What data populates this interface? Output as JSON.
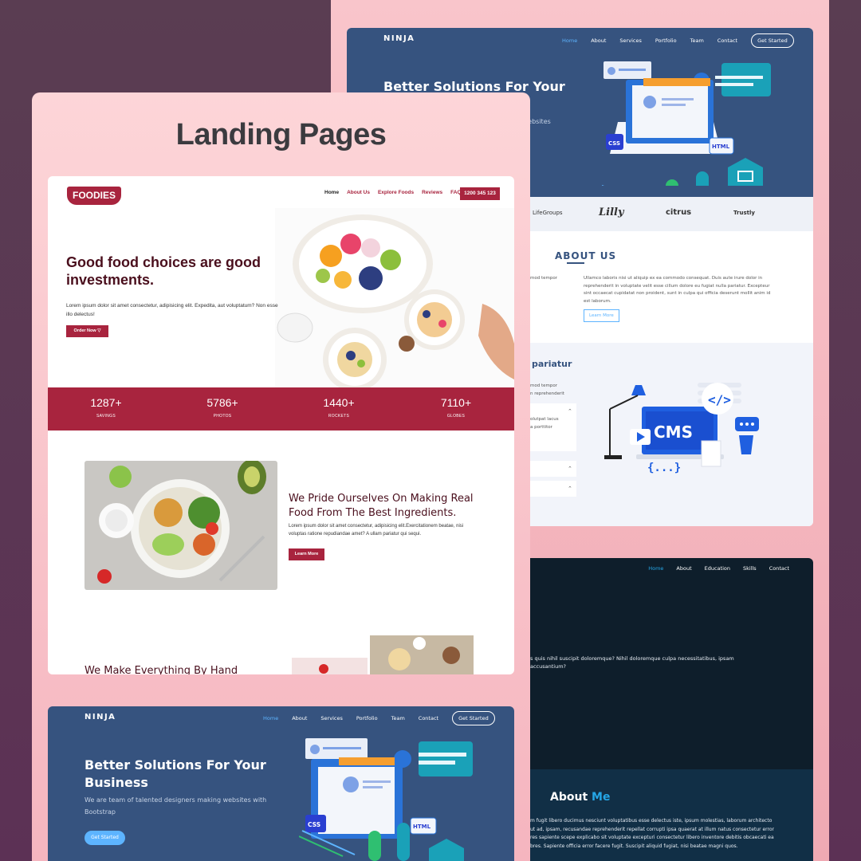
{
  "page_title": "Landing Pages",
  "colors": {
    "foodies_brand": "#a8243e",
    "ninja_brand": "#36537f",
    "ninja_accent": "#5db4ff",
    "dark_bg": "#0e1e2b"
  },
  "ninja_top": {
    "logo": "NINJA",
    "nav": [
      "Home",
      "About",
      "Services",
      "Portfolio",
      "Team",
      "Contact"
    ],
    "cta": "Get Started",
    "hero_heading": "Better Solutions For Your",
    "hero_sub_visible": "g websites",
    "partner_logos": [
      "LifeGroups",
      "Lilly",
      "citrus",
      "Trustly"
    ],
    "about_heading": "ABOUT US",
    "about_left": "mod tempor",
    "about_right": "Ullamco laboris nisi ut aliquip ex ea commodo consequat. Duis aute irure dolor in reprehenderit in voluptate velit esse cillum dolore eu fugiat nulla pariatur. Excepteur sint occaecat cupidatat non proident, sunt in culpa qui officia deserunt mollit anim id est laborum.",
    "about_button": "Learn More",
    "faq_heading": "pariatur",
    "faq_text_1": "mod tempor",
    "faq_text_2": "n reprehenderit",
    "faq_item_text": "olutpat lacus\na porttitor",
    "illustration_label": "CMS"
  },
  "dark_portfolio": {
    "nav": [
      "Home",
      "About",
      "Education",
      "Skills",
      "Contact"
    ],
    "intro_text": "s quis nihil suscipit doloremque? Nihil doloremque culpa necessitatibus, ipsam\naccusantium?",
    "about_heading_1": "About",
    "about_heading_2": "Me",
    "about_text": "m fugit libero ducimus nesciunt voluptatibus esse delectus iste, ipsum molestias, laborum architecto\nut ad, ipsam, recusandae reprehenderit repellat corrupti ipsa quaerat at illum natus consectetur error\nres sapiente scepe explicabo sit voluptate excepturi consectetur libero inventore debitis obcaecati ea\nbres. Sapiente officia error facere fugit. Suscipit aliquid fugiat, nisi beatae magni quos."
  },
  "foodies": {
    "logo": "FOODIES",
    "nav": [
      "Home",
      "About Us",
      "Explore Foods",
      "Reviews",
      "FAQ"
    ],
    "phone": "1200 345 123",
    "heading": "Good food choices are good investments.",
    "paragraph": "Lorem ipsum dolor sit amet consectetur, adipisicing elit. Expedita, aut voluptatum? Non esse illo delectus!",
    "order_button": "Order Now",
    "stats": [
      {
        "value": "1287+",
        "label": "SAVINGS"
      },
      {
        "value": "5786+",
        "label": "PHOTOS"
      },
      {
        "value": "1440+",
        "label": "ROCKETS"
      },
      {
        "value": "7110+",
        "label": "GLOBES"
      }
    ],
    "section2_heading": "We Pride Ourselves On Making Real Food From The Best Ingredients.",
    "section2_text": "Lorem ipsum dolor sit amet consectetur, adipisicing elit.Exercitationem beatae, nisi voluptas ratione repudiandae amet? A ullam pariatur qui sequi.",
    "learn_button": "Learn More",
    "section3_heading": "We Make Everything By Hand"
  },
  "ninja_bottom": {
    "logo": "NINJA",
    "nav": [
      "Home",
      "About",
      "Services",
      "Portfolio",
      "Team",
      "Contact"
    ],
    "cta": "Get Started",
    "hero_heading": "Better Solutions For Your Business",
    "hero_sub": "We are team of talented designers making websites with Bootstrap",
    "hero_button": "Get Started",
    "illustration_labels": [
      "CSS",
      "HTML"
    ]
  }
}
